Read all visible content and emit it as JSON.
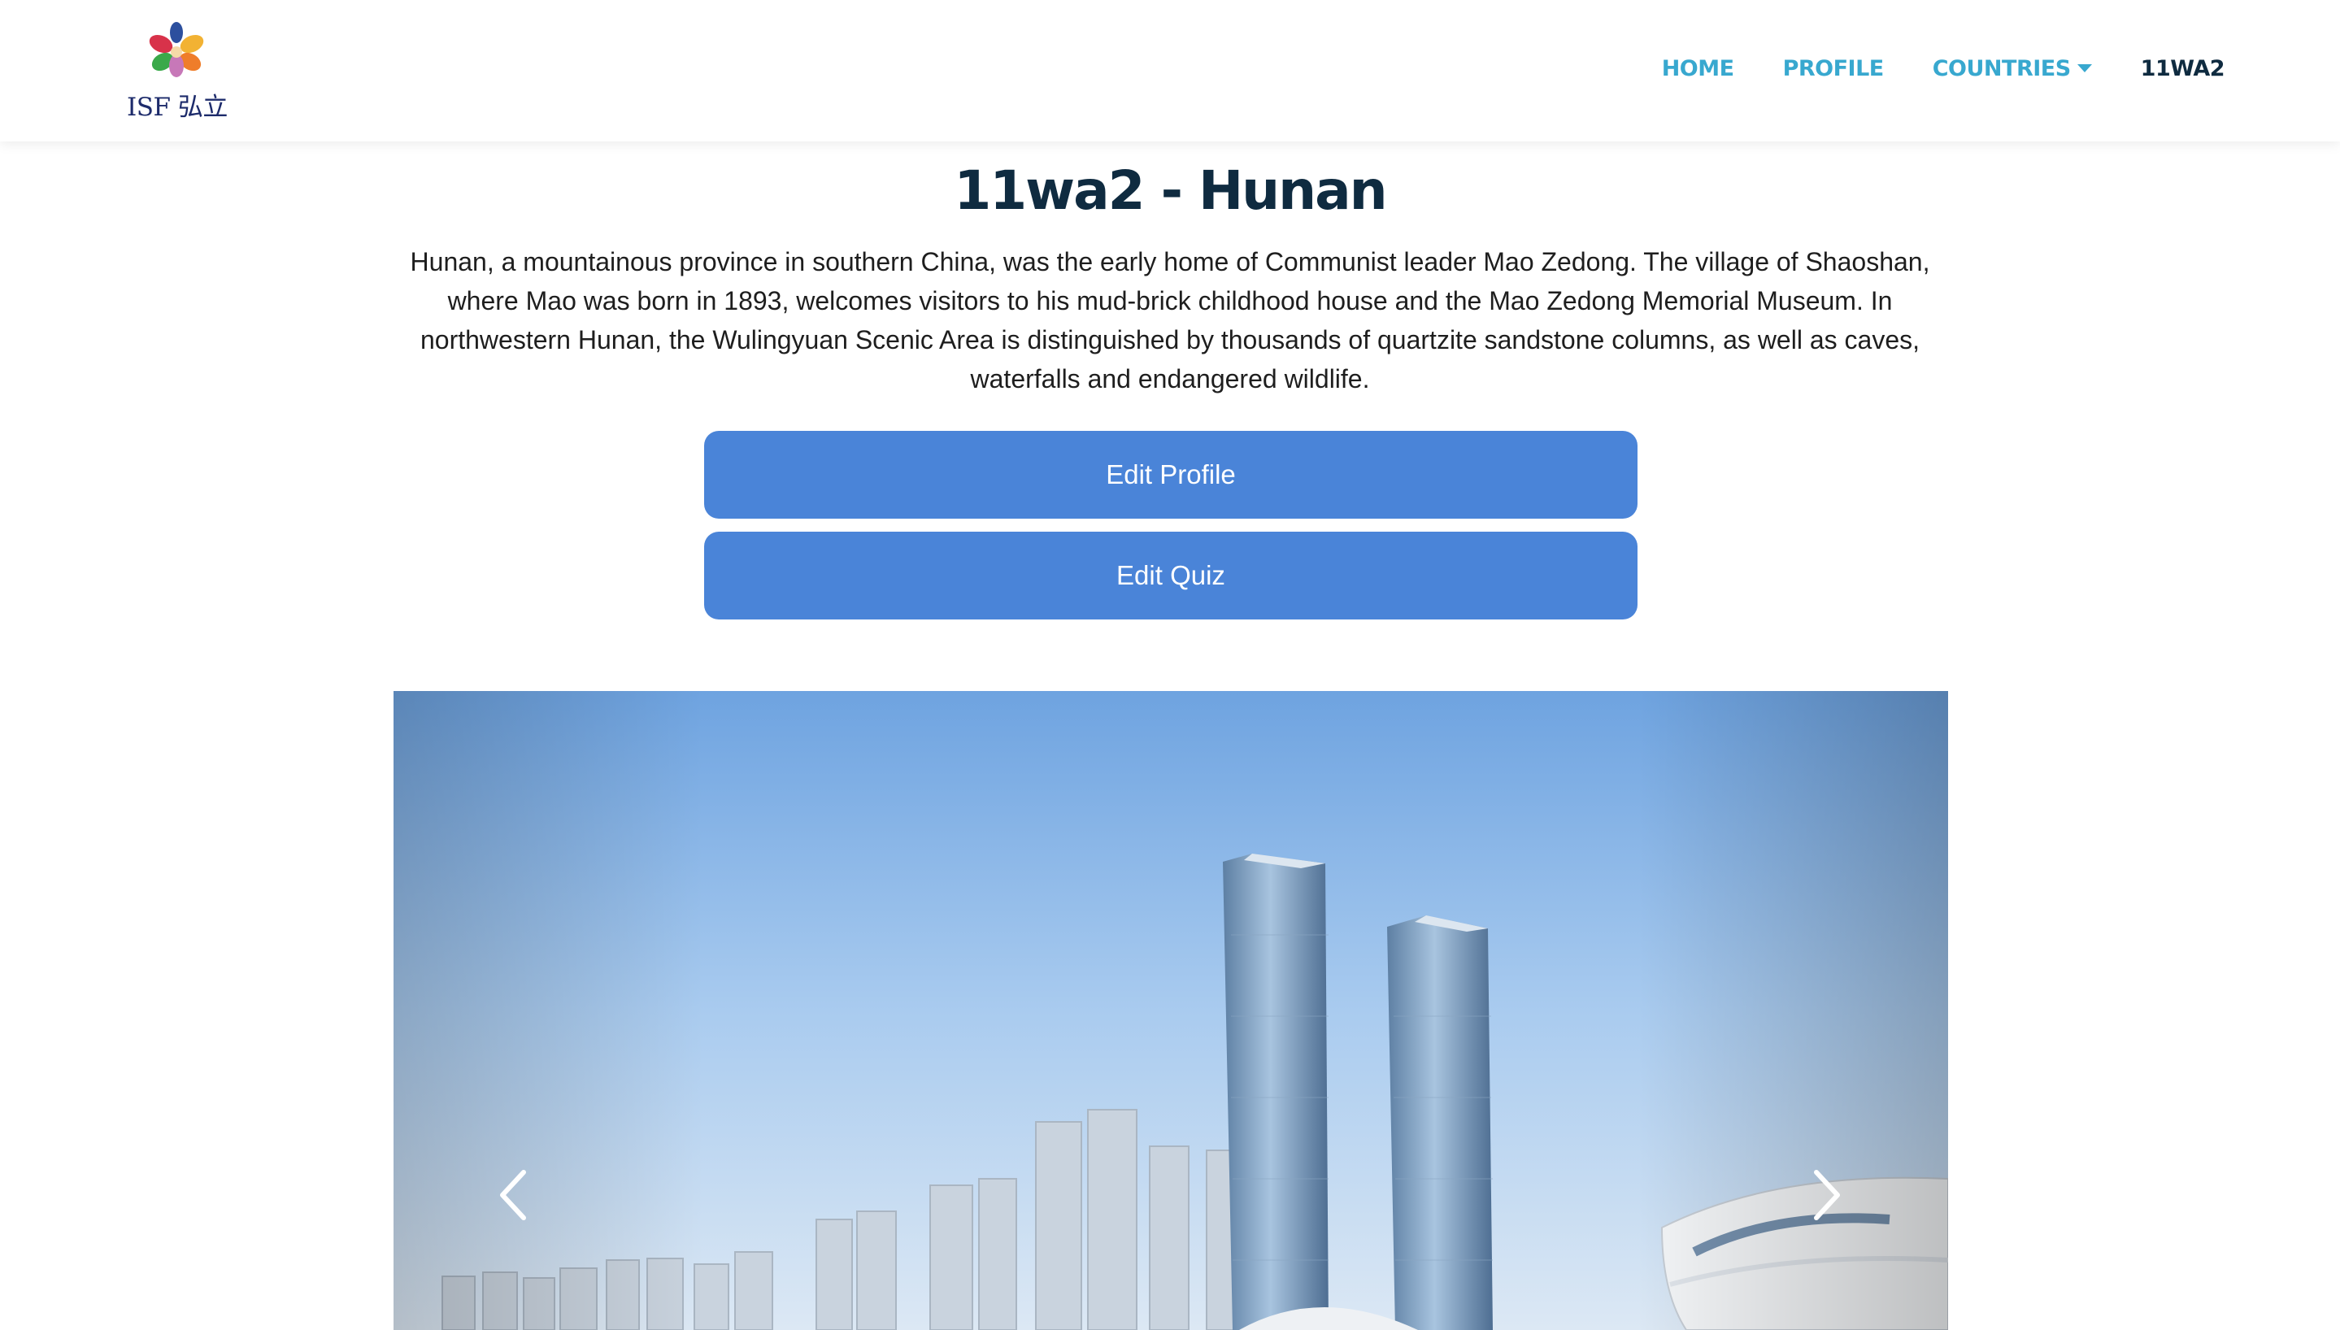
{
  "navbar": {
    "logo_text": "ISF 弘立",
    "items": [
      {
        "label": "HOME"
      },
      {
        "label": "PROFILE"
      },
      {
        "label": "COUNTRIES"
      },
      {
        "label": "11WA2"
      }
    ]
  },
  "main": {
    "title": "11wa2 - Hunan",
    "description": "Hunan, a mountainous province in southern China, was the early home of Communist leader Mao Zedong. The village of Shaoshan, where Mao was born in 1893, welcomes visitors to his mud-brick childhood house and the Mao Zedong Memorial Museum. In northwestern Hunan, the Wulingyuan Scenic Area is distinguished by thousands of quartzite sandstone columns, as well as caves, waterfalls and endangered wildlife.",
    "edit_profile_label": "Edit Profile",
    "edit_quiz_label": "Edit Quiz"
  },
  "carousel": {
    "prev_icon": "chevron-left-icon",
    "next_icon": "chevron-right-icon"
  },
  "colors": {
    "nav_link": "#38a8cf",
    "nav_active": "#0f2b40",
    "button": "#4a84d8",
    "title": "#0f2b40"
  }
}
